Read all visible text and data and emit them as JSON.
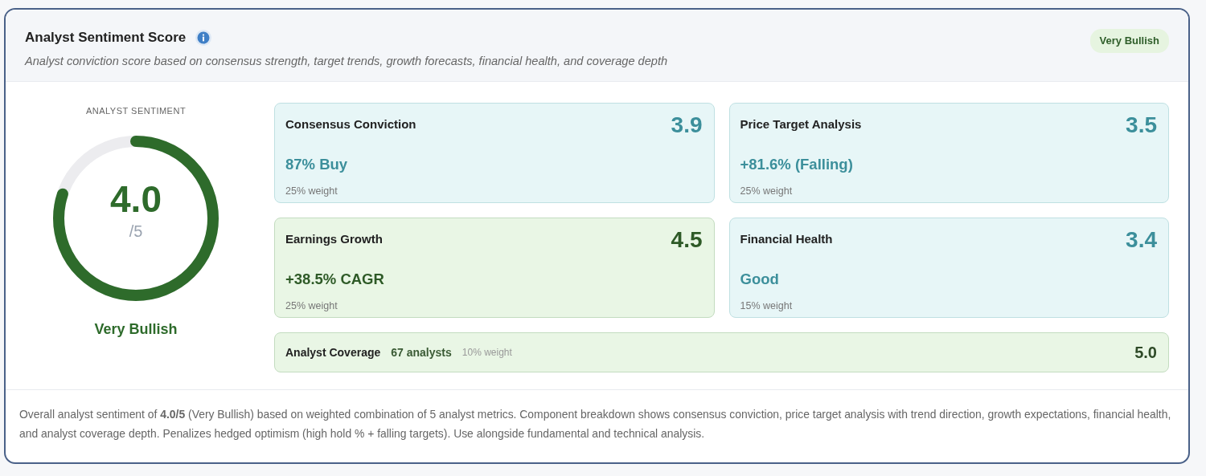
{
  "header": {
    "title": "Analyst Sentiment Score",
    "subtitle": "Analyst conviction score based on consensus strength, target trends, growth forecasts, financial health, and coverage depth",
    "badge": "Very Bullish"
  },
  "gauge": {
    "caption": "ANALYST SENTIMENT",
    "score": "4.0",
    "scale": "/5",
    "level": 0.8,
    "rating": "Very Bullish"
  },
  "metrics": [
    {
      "title": "Consensus Conviction",
      "score": "3.9",
      "detail": "87% Buy",
      "weight": "25% weight",
      "kind": "neutral"
    },
    {
      "title": "Price Target Analysis",
      "score": "3.5",
      "detail": "+81.6% (Falling)",
      "weight": "25% weight",
      "kind": "neutral"
    },
    {
      "title": "Earnings Growth",
      "score": "4.5",
      "detail": "+38.5% CAGR",
      "weight": "25% weight",
      "kind": "strong"
    },
    {
      "title": "Financial Health",
      "score": "3.4",
      "detail": "Good",
      "weight": "15% weight",
      "kind": "neutral"
    }
  ],
  "coverage": {
    "title": "Analyst Coverage",
    "detail": "67 analysts",
    "weight": "10% weight",
    "score": "5.0"
  },
  "footer": "Overall analyst sentiment of **4.0/5** (Very Bullish) based on weighted combination of 5 analyst metrics. Component breakdown shows consensus conviction, price target analysis with trend direction, growth expectations, financial health, and analyst coverage depth. Penalizes hedged optimism (high hold % + falling targets). Use alongside fundamental and technical analysis."
}
